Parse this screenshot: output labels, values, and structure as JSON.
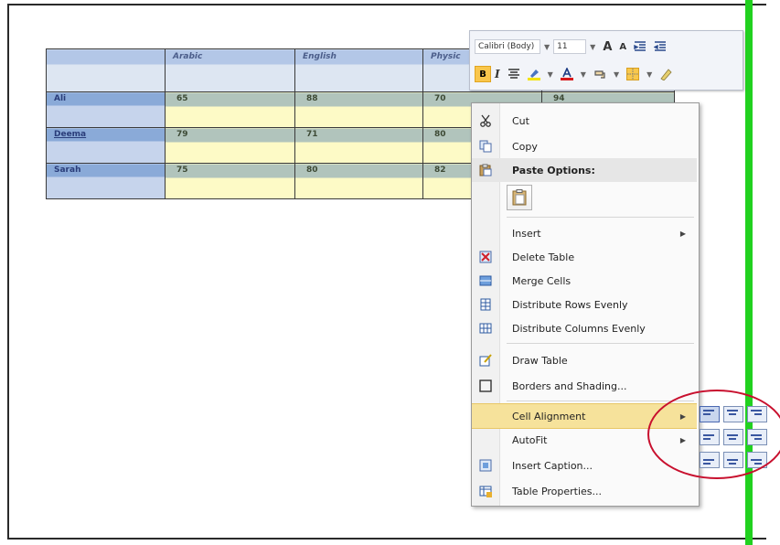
{
  "table": {
    "headers": [
      "",
      "Arabic",
      "English",
      "Physic",
      ""
    ],
    "rows": [
      {
        "name": "Ali",
        "values": [
          "65",
          "88",
          "70",
          "94"
        ]
      },
      {
        "name": "Deema",
        "values": [
          "79",
          "71",
          "80",
          ""
        ]
      },
      {
        "name": "Sarah",
        "values": [
          "75",
          "80",
          "82",
          ""
        ]
      }
    ]
  },
  "minibar": {
    "font": "Calibri (Body)",
    "size": "11",
    "grow": "A",
    "shrink": "A",
    "bold": "B",
    "italic": "I"
  },
  "menu": {
    "cut": "Cut",
    "copy": "Copy",
    "paste_options": "Paste Options:",
    "insert": "Insert",
    "delete_table": "Delete Table",
    "merge_cells": "Merge Cells",
    "distribute_rows": "Distribute Rows Evenly",
    "distribute_cols": "Distribute Columns Evenly",
    "draw_table": "Draw Table",
    "borders_shading": "Borders and Shading...",
    "cell_alignment": "Cell Alignment",
    "autofit": "AutoFit",
    "insert_caption": "Insert Caption...",
    "table_properties": "Table Properties..."
  },
  "colors": {
    "highlight": "#f6e29b",
    "annotation_circle": "#c8102e",
    "green_marker": "#21d11f"
  }
}
